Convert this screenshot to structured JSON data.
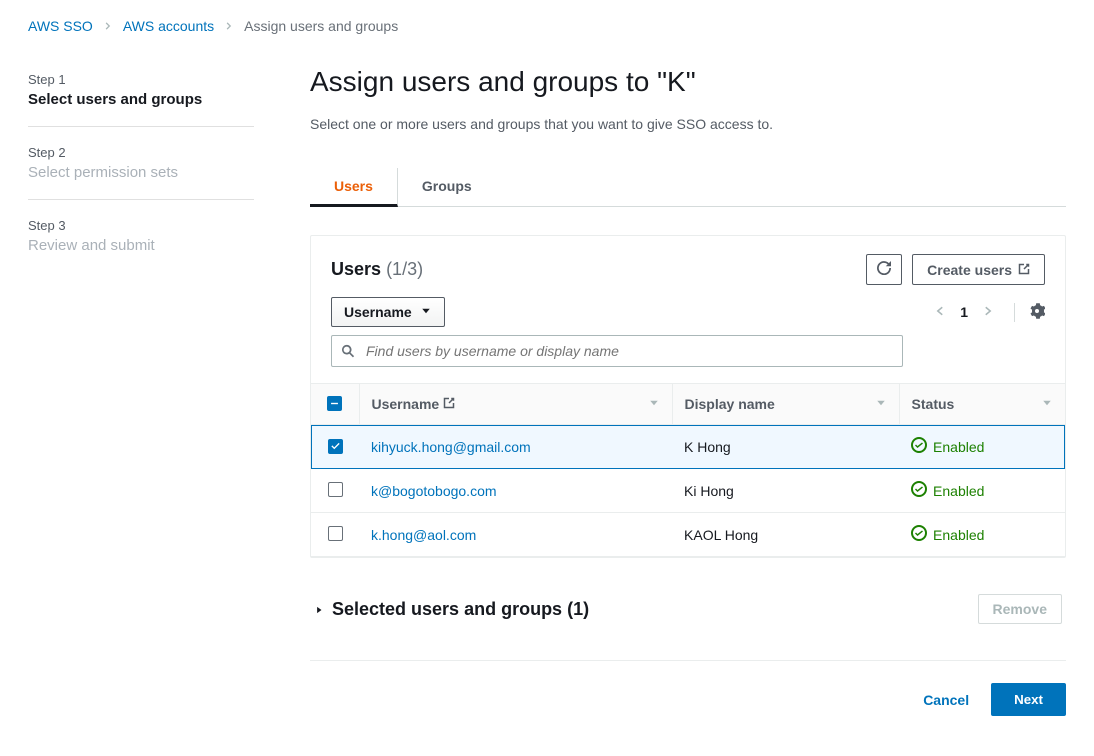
{
  "breadcrumb": {
    "item1": "AWS SSO",
    "item2": "AWS accounts",
    "current": "Assign users and groups"
  },
  "sidebar": {
    "steps": [
      {
        "label": "Step 1",
        "title": "Select users and groups"
      },
      {
        "label": "Step 2",
        "title": "Select permission sets"
      },
      {
        "label": "Step 3",
        "title": "Review and submit"
      }
    ]
  },
  "main": {
    "heading": "Assign users and groups to \"K\"",
    "subtitle": "Select one or more users and groups that you want to give SSO access to.",
    "tabs": {
      "users": "Users",
      "groups": "Groups"
    },
    "users_card": {
      "title": "Users",
      "count": "(1/3)",
      "create_label": "Create users",
      "filter": {
        "dropdown": "Username",
        "placeholder": "Find users by username or display name",
        "page": "1"
      },
      "columns": {
        "username": "Username",
        "display": "Display name",
        "status": "Status"
      },
      "rows": [
        {
          "username": "kihyuck.hong@gmail.com",
          "display": "K Hong",
          "status": "Enabled"
        },
        {
          "username": "k@bogotobogo.com",
          "display": "Ki Hong",
          "status": "Enabled"
        },
        {
          "username": "k.hong@aol.com",
          "display": "KAOL Hong",
          "status": "Enabled"
        }
      ]
    },
    "selected": {
      "title": "Selected users and groups (1)",
      "remove": "Remove"
    },
    "footer": {
      "cancel": "Cancel",
      "next": "Next"
    }
  }
}
